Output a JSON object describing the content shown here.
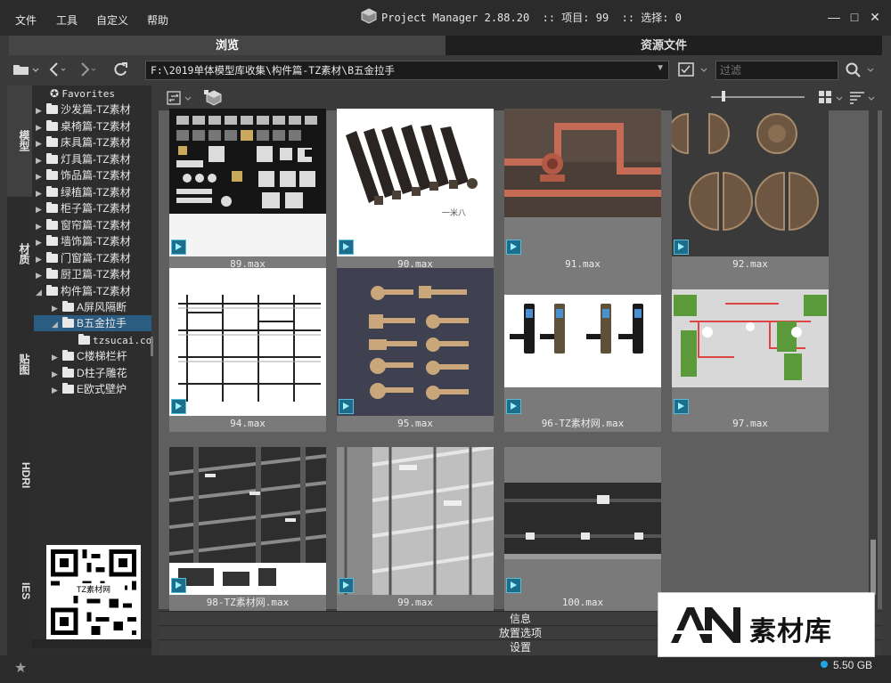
{
  "menu": {
    "file": "文件",
    "tools": "工具",
    "custom": "自定义",
    "help": "帮助"
  },
  "title": {
    "text": "Project Manager 2.88.20  :: 项目: 99  :: 选择: 0"
  },
  "window_controls": {
    "minimize": "—",
    "maximize": "□",
    "close": "✕"
  },
  "tabs": {
    "browse": "浏览",
    "resources": "资源文件"
  },
  "address": {
    "path": "F:\\2019单体模型库收集\\构件篇-TZ素材\\B五金拉手",
    "filter_placeholder": "过滤"
  },
  "vertical_tabs": {
    "models": "模型",
    "materials": "材质",
    "maps": "贴图",
    "hdri": "HDRI",
    "ies": "IES"
  },
  "tree": {
    "favorites": "Favorites",
    "items": [
      "沙发篇-TZ素材",
      "桌椅篇-TZ素材",
      "床具篇-TZ素材",
      "灯具篇-TZ素材",
      "饰品篇-TZ素材",
      "绿植篇-TZ素材",
      "柜子篇-TZ素材",
      "窗帘篇-TZ素材",
      "墙饰篇-TZ素材",
      "门窗篇-TZ素材",
      "厨卫篇-TZ素材",
      "构件篇-TZ素材"
    ],
    "children": [
      "A屏风隔断",
      "B五金拉手",
      "C楼梯栏杆",
      "D柱子雕花",
      "E欧式壁炉"
    ],
    "grandchild": "tzsucai.co"
  },
  "qr_label": "TZ素材网",
  "items": [
    {
      "name": "89.max",
      "thumb_bg": "#f2f2f2"
    },
    {
      "name": "90.max",
      "thumb_bg": "#ffffff"
    },
    {
      "name": "91.max",
      "thumb_bg": "#3a302a"
    },
    {
      "name": "92.max",
      "thumb_bg": "#3c3c3c"
    },
    {
      "name": "94.max",
      "thumb_bg": "#ffffff"
    },
    {
      "name": "95.max",
      "thumb_bg": "#3f4050"
    },
    {
      "name": "96-TZ素材网.max",
      "thumb_bg": "#ffffff"
    },
    {
      "name": "97.max",
      "thumb_bg": "#d0d0d0"
    },
    {
      "name": "98-TZ素材网.max",
      "thumb_bg": "#2a2a2a"
    },
    {
      "name": "99.max",
      "thumb_bg": "#a8a8a8"
    },
    {
      "name": "100.max",
      "thumb_bg": "#2e2e2e"
    }
  ],
  "thumb_texts": {
    "brand": "一米八"
  },
  "bottom_bars": {
    "info": "信息",
    "placement": "放置选项",
    "settings": "设置"
  },
  "status": {
    "disk": "5.50 GB"
  },
  "watermark": {
    "brand": "素材库",
    "letters": "AN"
  },
  "colors": {
    "accent": "#1ea7e0",
    "max_icon": "#1d6e8c"
  }
}
